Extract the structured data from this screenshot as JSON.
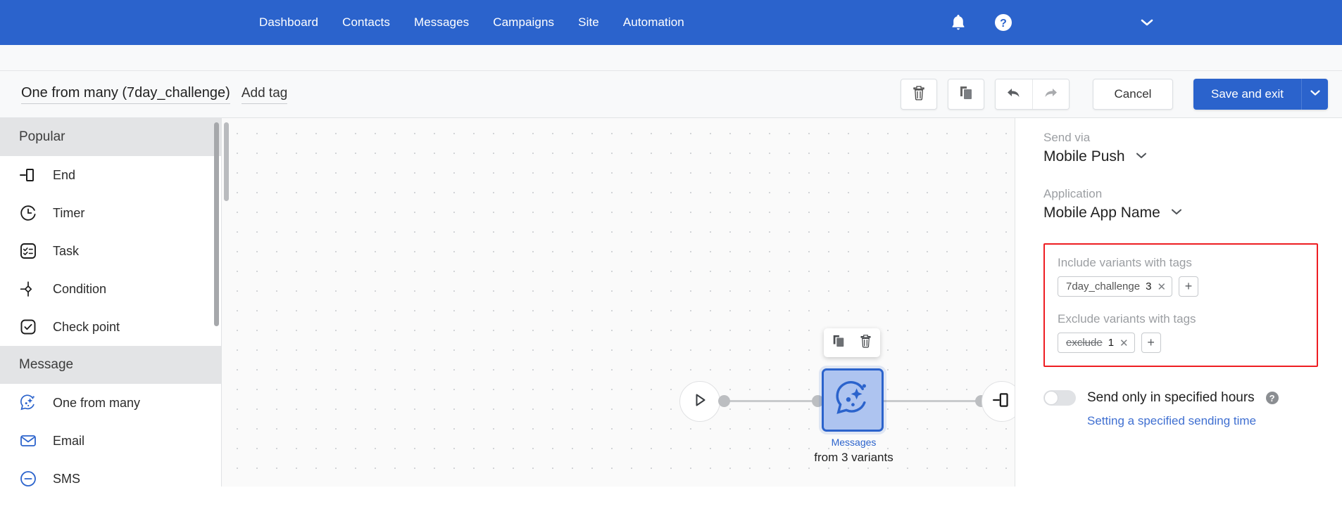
{
  "topnav": {
    "links": [
      {
        "label": "Dashboard",
        "name": "nav-dashboard"
      },
      {
        "label": "Contacts",
        "name": "nav-contacts"
      },
      {
        "label": "Messages",
        "name": "nav-messages"
      },
      {
        "label": "Campaigns",
        "name": "nav-campaigns"
      },
      {
        "label": "Site",
        "name": "nav-site"
      },
      {
        "label": "Automation",
        "name": "nav-automation"
      }
    ],
    "icons": {
      "bell": "bell-icon",
      "help": "help-circle-icon",
      "account_caret": "chevron-down-icon"
    },
    "background": "#2b63cc"
  },
  "toolbar": {
    "flow_title": "One from many (7day_challenge)",
    "add_tag_label": "Add tag",
    "delete_icon": "trash-icon",
    "duplicate_icon": "copy-icon",
    "undo_icon": "undo-arrow-icon",
    "redo_icon": "redo-arrow-icon",
    "cancel_label": "Cancel",
    "save_label": "Save and exit",
    "save_caret_icon": "chevron-down-icon",
    "save_color": "#2b63cc"
  },
  "palette": {
    "sections": [
      {
        "title": "Popular",
        "items": [
          {
            "label": "End",
            "icon": "end-node-icon"
          },
          {
            "label": "Timer",
            "icon": "timer-clock-icon"
          },
          {
            "label": "Task",
            "icon": "task-checklist-icon"
          },
          {
            "label": "Condition",
            "icon": "condition-diamond-icon"
          },
          {
            "label": "Check point",
            "icon": "check-point-icon"
          }
        ]
      },
      {
        "title": "Message",
        "items": [
          {
            "label": "One from many",
            "icon": "one-from-many-icon"
          },
          {
            "label": "Email",
            "icon": "email-envelope-icon"
          },
          {
            "label": "SMS",
            "icon": "sms-icon"
          }
        ]
      }
    ]
  },
  "canvas": {
    "start_node_icon": "play-triangle-icon",
    "end_node_icon": "end-node-icon",
    "message_node": {
      "icon": "one-from-many-icon",
      "caption_title": "Messages",
      "caption_sub": "from 3 variants",
      "border_color": "#2b63cc",
      "fill_color": "#aec4f0"
    },
    "node_toolbar": {
      "duplicate_icon": "copy-icon",
      "delete_icon": "trash-icon"
    }
  },
  "right_panel": {
    "send_via": {
      "label": "Send via",
      "value": "Mobile Push",
      "caret_icon": "chevron-down-icon"
    },
    "application": {
      "label": "Application",
      "value": "Mobile App Name",
      "caret_icon": "chevron-down-icon"
    },
    "tag_box": {
      "highlight_color": "#ee1d22",
      "include": {
        "label": "Include variants with tags",
        "chip_name": "7day_challenge",
        "chip_count": "3",
        "remove_icon": "close-x-icon",
        "add_label": "+"
      },
      "exclude": {
        "label": "Exclude variants with tags",
        "chip_name": "exclude",
        "chip_count": "1",
        "remove_icon": "close-x-icon",
        "add_label": "+"
      }
    },
    "specified_hours": {
      "toggle_state": "off",
      "label": "Send only in specified hours",
      "help_icon": "help-circle-icon",
      "help_glyph": "?",
      "link_label": "Setting a specified sending time",
      "link_color": "#3f6fd1"
    }
  }
}
